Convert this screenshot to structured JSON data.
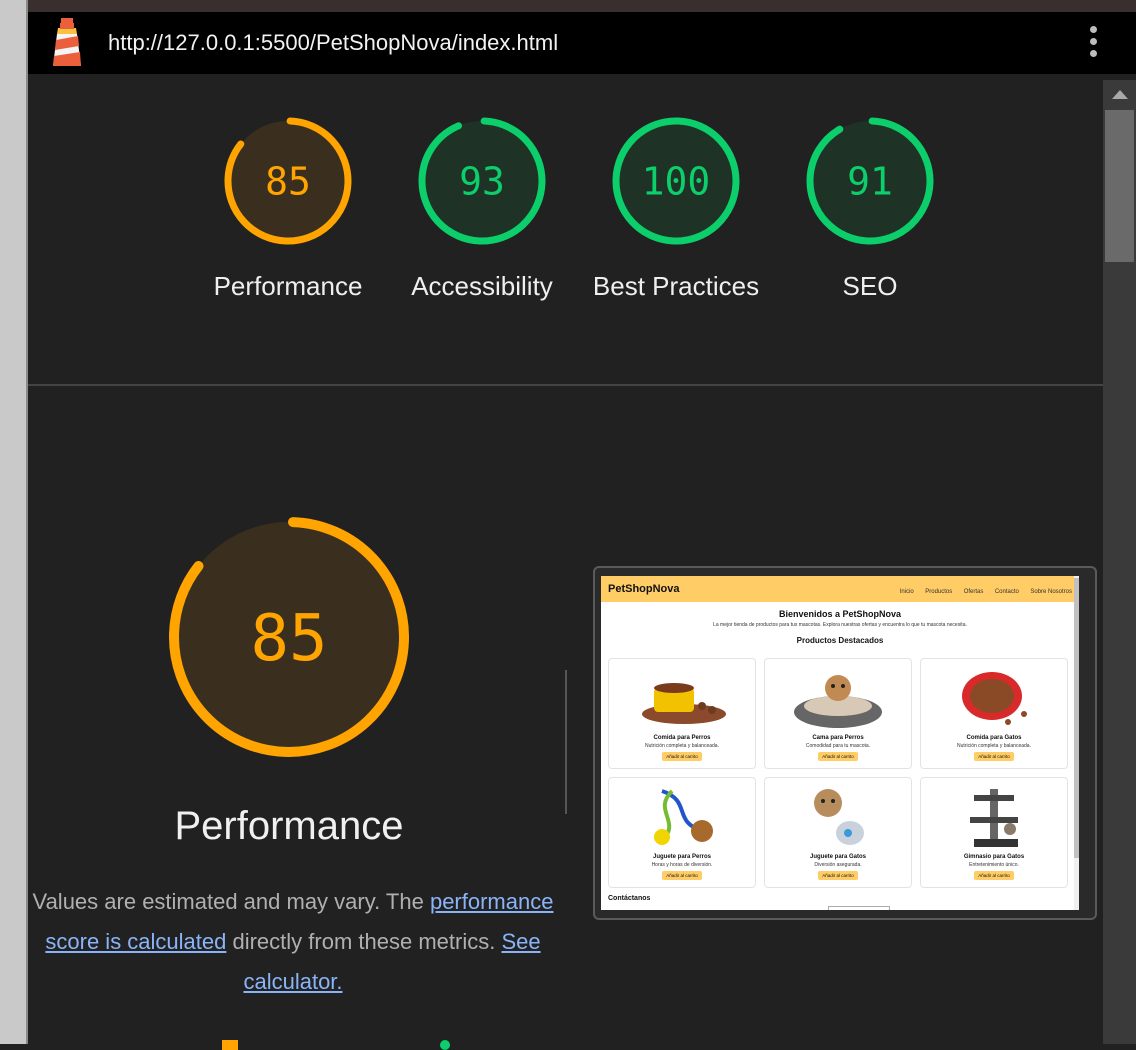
{
  "browser": {
    "url": "http://127.0.0.1:5500/PetShopNova/index.html",
    "logo_icon": "lighthouse-icon",
    "menu_icon": "kebab-menu-icon"
  },
  "colors": {
    "average": "#ffa400",
    "pass": "#0cce6b",
    "average_bg": "#3a2f1e",
    "pass_bg": "#1e3326",
    "link": "#8ab4f8"
  },
  "scores": [
    {
      "value": 85,
      "label": "Performance",
      "status": "average"
    },
    {
      "value": 93,
      "label": "Accessibility",
      "status": "pass"
    },
    {
      "value": 100,
      "label": "Best Practices",
      "status": "pass"
    },
    {
      "value": 91,
      "label": "SEO",
      "status": "pass"
    }
  ],
  "performance": {
    "value": 85,
    "title": "Performance",
    "desc_1": "Values are estimated and may vary. The ",
    "desc_link_1": "performance score is calculated",
    "desc_2": " directly from these metrics. ",
    "desc_link_2": "See calculator."
  },
  "screenshot": {
    "brand": "PetShopNova",
    "nav": [
      "Inicio",
      "Productos",
      "Ofertas",
      "Contacto",
      "Sobre Nosotros"
    ],
    "welcome": "Bienvenidos a PetShopNova",
    "subtitle": "La mejor tienda de productos para tus mascotas. Explora nuestras ofertas y encuentra lo que tu mascota necesita.",
    "featured": "Productos Destacados",
    "products": [
      {
        "title": "Comida para Perros",
        "desc": "Nutrición completa y balanceada.",
        "button": "Añadir al carrito",
        "image": "dog-food-bowl"
      },
      {
        "title": "Cama para Perros",
        "desc": "Comodidad para tu mascota.",
        "button": "Añadir al carrito",
        "image": "dog-bed"
      },
      {
        "title": "Comida para Gatos",
        "desc": "Nutrición completa y balanceada.",
        "button": "Añadir al carrito",
        "image": "cat-food-bowl"
      },
      {
        "title": "Juguete para Perros",
        "desc": "Horas y horas de diversión.",
        "button": "Añadir al carrito",
        "image": "dog-rope-toy"
      },
      {
        "title": "Juguete para Gatos",
        "desc": "Diversión asegurada.",
        "button": "Añadir al carrito",
        "image": "cat-toy"
      },
      {
        "title": "Gimnasio para Gatos",
        "desc": "Entretenimiento único.",
        "button": "Añadir al carrito",
        "image": "cat-tree"
      }
    ],
    "contact": "Contáctanos"
  }
}
